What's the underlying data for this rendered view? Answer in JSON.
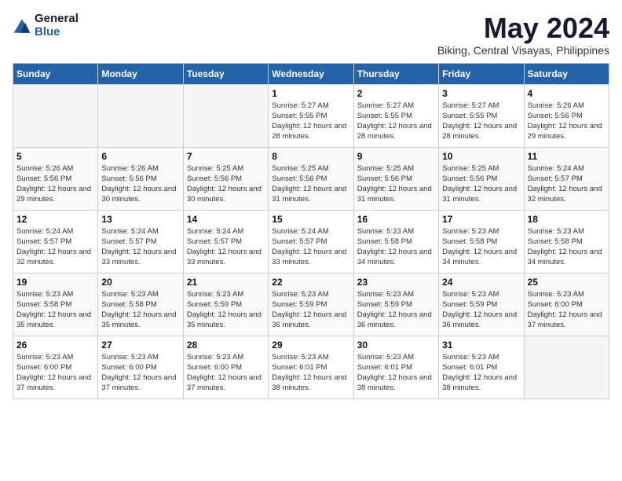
{
  "logo": {
    "text1": "General",
    "text2": "Blue"
  },
  "title": "May 2024",
  "subtitle": "Biking, Central Visayas, Philippines",
  "weekdays": [
    "Sunday",
    "Monday",
    "Tuesday",
    "Wednesday",
    "Thursday",
    "Friday",
    "Saturday"
  ],
  "weeks": [
    [
      {
        "day": "",
        "sunrise": "",
        "sunset": "",
        "daylight": ""
      },
      {
        "day": "",
        "sunrise": "",
        "sunset": "",
        "daylight": ""
      },
      {
        "day": "",
        "sunrise": "",
        "sunset": "",
        "daylight": ""
      },
      {
        "day": "1",
        "sunrise": "Sunrise: 5:27 AM",
        "sunset": "Sunset: 5:55 PM",
        "daylight": "Daylight: 12 hours and 28 minutes."
      },
      {
        "day": "2",
        "sunrise": "Sunrise: 5:27 AM",
        "sunset": "Sunset: 5:55 PM",
        "daylight": "Daylight: 12 hours and 28 minutes."
      },
      {
        "day": "3",
        "sunrise": "Sunrise: 5:27 AM",
        "sunset": "Sunset: 5:55 PM",
        "daylight": "Daylight: 12 hours and 28 minutes."
      },
      {
        "day": "4",
        "sunrise": "Sunrise: 5:26 AM",
        "sunset": "Sunset: 5:56 PM",
        "daylight": "Daylight: 12 hours and 29 minutes."
      }
    ],
    [
      {
        "day": "5",
        "sunrise": "Sunrise: 5:26 AM",
        "sunset": "Sunset: 5:56 PM",
        "daylight": "Daylight: 12 hours and 29 minutes."
      },
      {
        "day": "6",
        "sunrise": "Sunrise: 5:26 AM",
        "sunset": "Sunset: 5:56 PM",
        "daylight": "Daylight: 12 hours and 30 minutes."
      },
      {
        "day": "7",
        "sunrise": "Sunrise: 5:25 AM",
        "sunset": "Sunset: 5:56 PM",
        "daylight": "Daylight: 12 hours and 30 minutes."
      },
      {
        "day": "8",
        "sunrise": "Sunrise: 5:25 AM",
        "sunset": "Sunset: 5:56 PM",
        "daylight": "Daylight: 12 hours and 31 minutes."
      },
      {
        "day": "9",
        "sunrise": "Sunrise: 5:25 AM",
        "sunset": "Sunset: 5:56 PM",
        "daylight": "Daylight: 12 hours and 31 minutes."
      },
      {
        "day": "10",
        "sunrise": "Sunrise: 5:25 AM",
        "sunset": "Sunset: 5:56 PM",
        "daylight": "Daylight: 12 hours and 31 minutes."
      },
      {
        "day": "11",
        "sunrise": "Sunrise: 5:24 AM",
        "sunset": "Sunset: 5:57 PM",
        "daylight": "Daylight: 12 hours and 32 minutes."
      }
    ],
    [
      {
        "day": "12",
        "sunrise": "Sunrise: 5:24 AM",
        "sunset": "Sunset: 5:57 PM",
        "daylight": "Daylight: 12 hours and 32 minutes."
      },
      {
        "day": "13",
        "sunrise": "Sunrise: 5:24 AM",
        "sunset": "Sunset: 5:57 PM",
        "daylight": "Daylight: 12 hours and 33 minutes."
      },
      {
        "day": "14",
        "sunrise": "Sunrise: 5:24 AM",
        "sunset": "Sunset: 5:57 PM",
        "daylight": "Daylight: 12 hours and 33 minutes."
      },
      {
        "day": "15",
        "sunrise": "Sunrise: 5:24 AM",
        "sunset": "Sunset: 5:57 PM",
        "daylight": "Daylight: 12 hours and 33 minutes."
      },
      {
        "day": "16",
        "sunrise": "Sunrise: 5:23 AM",
        "sunset": "Sunset: 5:58 PM",
        "daylight": "Daylight: 12 hours and 34 minutes."
      },
      {
        "day": "17",
        "sunrise": "Sunrise: 5:23 AM",
        "sunset": "Sunset: 5:58 PM",
        "daylight": "Daylight: 12 hours and 34 minutes."
      },
      {
        "day": "18",
        "sunrise": "Sunrise: 5:23 AM",
        "sunset": "Sunset: 5:58 PM",
        "daylight": "Daylight: 12 hours and 34 minutes."
      }
    ],
    [
      {
        "day": "19",
        "sunrise": "Sunrise: 5:23 AM",
        "sunset": "Sunset: 5:58 PM",
        "daylight": "Daylight: 12 hours and 35 minutes."
      },
      {
        "day": "20",
        "sunrise": "Sunrise: 5:23 AM",
        "sunset": "Sunset: 5:58 PM",
        "daylight": "Daylight: 12 hours and 35 minutes."
      },
      {
        "day": "21",
        "sunrise": "Sunrise: 5:23 AM",
        "sunset": "Sunset: 5:59 PM",
        "daylight": "Daylight: 12 hours and 35 minutes."
      },
      {
        "day": "22",
        "sunrise": "Sunrise: 5:23 AM",
        "sunset": "Sunset: 5:59 PM",
        "daylight": "Daylight: 12 hours and 36 minutes."
      },
      {
        "day": "23",
        "sunrise": "Sunrise: 5:23 AM",
        "sunset": "Sunset: 5:59 PM",
        "daylight": "Daylight: 12 hours and 36 minutes."
      },
      {
        "day": "24",
        "sunrise": "Sunrise: 5:23 AM",
        "sunset": "Sunset: 5:59 PM",
        "daylight": "Daylight: 12 hours and 36 minutes."
      },
      {
        "day": "25",
        "sunrise": "Sunrise: 5:23 AM",
        "sunset": "Sunset: 6:00 PM",
        "daylight": "Daylight: 12 hours and 37 minutes."
      }
    ],
    [
      {
        "day": "26",
        "sunrise": "Sunrise: 5:23 AM",
        "sunset": "Sunset: 6:00 PM",
        "daylight": "Daylight: 12 hours and 37 minutes."
      },
      {
        "day": "27",
        "sunrise": "Sunrise: 5:23 AM",
        "sunset": "Sunset: 6:00 PM",
        "daylight": "Daylight: 12 hours and 37 minutes."
      },
      {
        "day": "28",
        "sunrise": "Sunrise: 5:23 AM",
        "sunset": "Sunset: 6:00 PM",
        "daylight": "Daylight: 12 hours and 37 minutes."
      },
      {
        "day": "29",
        "sunrise": "Sunrise: 5:23 AM",
        "sunset": "Sunset: 6:01 PM",
        "daylight": "Daylight: 12 hours and 38 minutes."
      },
      {
        "day": "30",
        "sunrise": "Sunrise: 5:23 AM",
        "sunset": "Sunset: 6:01 PM",
        "daylight": "Daylight: 12 hours and 38 minutes."
      },
      {
        "day": "31",
        "sunrise": "Sunrise: 5:23 AM",
        "sunset": "Sunset: 6:01 PM",
        "daylight": "Daylight: 12 hours and 38 minutes."
      },
      {
        "day": "",
        "sunrise": "",
        "sunset": "",
        "daylight": ""
      }
    ]
  ]
}
